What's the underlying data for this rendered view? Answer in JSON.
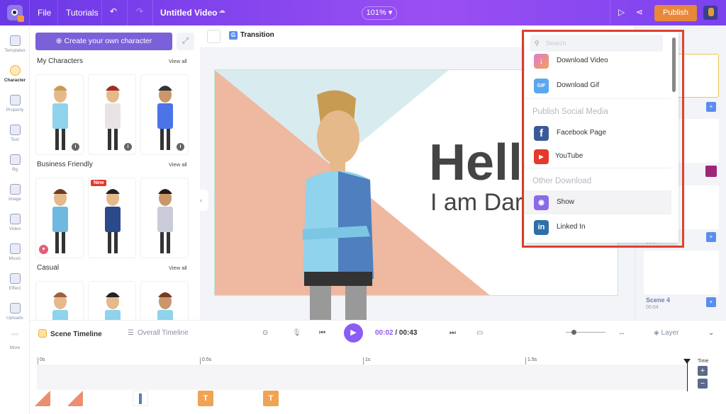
{
  "topbar": {
    "file": "File",
    "tutorials": "Tutorials",
    "title": "Untitled Video",
    "zoom": "101%",
    "publish": "Publish"
  },
  "rail": [
    {
      "label": "Templates"
    },
    {
      "label": "Character"
    },
    {
      "label": "Property"
    },
    {
      "label": "Text"
    },
    {
      "label": "Bg"
    },
    {
      "label": "Image"
    },
    {
      "label": "Video"
    },
    {
      "label": "Music"
    },
    {
      "label": "Effect"
    },
    {
      "label": "Uploads"
    },
    {
      "label": "More"
    }
  ],
  "panel": {
    "create": "Create your own character",
    "sections": [
      {
        "title": "My Characters",
        "view_all": "View all"
      },
      {
        "title": "Business Friendly",
        "view_all": "View all",
        "badge": "New"
      },
      {
        "title": "Casual",
        "view_all": "View all"
      }
    ]
  },
  "canvas": {
    "transition": "Transition",
    "headline": "Hello",
    "subline": "I am Dar"
  },
  "scenes": {
    "duration_a": "00:04",
    "scene4": "Scene 4",
    "duration_b": "00:04"
  },
  "dropdown": {
    "search_placeholder": "Search",
    "items_top": [
      {
        "label": "Download Video",
        "icon": "download-video-icon"
      },
      {
        "label": "Download Gif",
        "icon": "gif-icon"
      }
    ],
    "social_header": "Publish Social Media",
    "social": [
      {
        "label": "Facebook Page",
        "icon": "facebook-icon"
      },
      {
        "label": "YouTube",
        "icon": "youtube-icon"
      }
    ],
    "other_header": "Other Download",
    "other": [
      {
        "label": "Show",
        "icon": "show-icon"
      },
      {
        "label": "Linked In",
        "icon": "linkedin-icon"
      }
    ]
  },
  "timeline": {
    "scene_tab": "Scene Timeline",
    "overall_tab": "Overall Timeline",
    "current": "00:02",
    "total": "/ 00:43",
    "layer": "Layer",
    "ticks": [
      "0s",
      "0.5s",
      "1s",
      "1.5s"
    ],
    "time_label": "Time"
  },
  "colors": {
    "accent": "#7b61d9",
    "publish": "#e8883a",
    "highlight": "#e2412f"
  }
}
